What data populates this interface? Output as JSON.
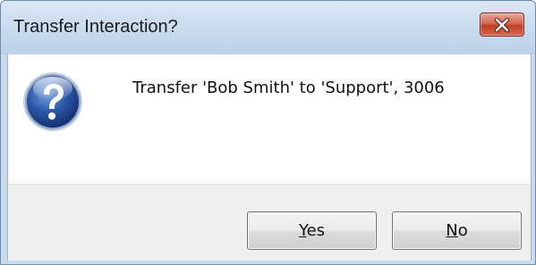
{
  "dialog": {
    "title": "Transfer Interaction?",
    "message": "Transfer 'Bob Smith' to 'Support', 3006",
    "icon": "question-icon",
    "close_icon": "close-icon",
    "buttons": {
      "yes": {
        "mnemonic": "Y",
        "rest": "es"
      },
      "no": {
        "mnemonic": "N",
        "rest": "o"
      }
    }
  },
  "colors": {
    "titlebar": "#c9dcef",
    "close_button": "#c94a32",
    "icon_blue": "#2a56a8",
    "footer": "#f0f0f0"
  }
}
